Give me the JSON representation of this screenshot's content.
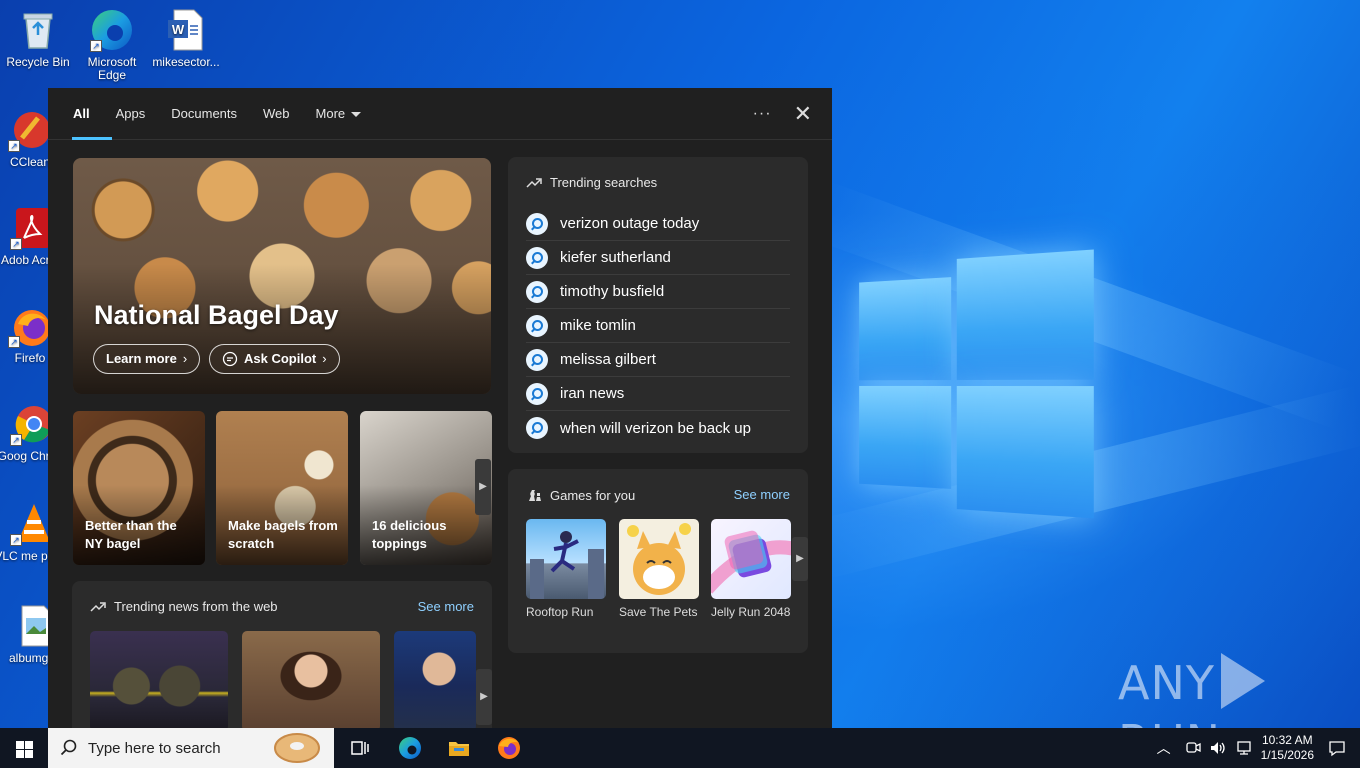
{
  "desktop": {
    "icons": [
      {
        "label": "Recycle Bin"
      },
      {
        "label": "Microsoft Edge"
      },
      {
        "label": "mikesector..."
      },
      {
        "label": "CClean"
      },
      {
        "label": "Adob Acrob"
      },
      {
        "label": "Firefo"
      },
      {
        "label": "Goog Chrom"
      },
      {
        "label": "VLC me playe"
      },
      {
        "label": "albumge"
      }
    ],
    "watermark": "ANY RUN"
  },
  "search_panel": {
    "tabs": [
      {
        "label": "All",
        "active": true
      },
      {
        "label": "Apps"
      },
      {
        "label": "Documents"
      },
      {
        "label": "Web"
      },
      {
        "label": "More"
      }
    ],
    "more_options": "···",
    "close": "✕",
    "hero": {
      "title": "National Bagel Day",
      "learn_more": "Learn more",
      "ask_copilot": "Ask Copilot"
    },
    "cards": [
      {
        "caption": "Better than the NY bagel"
      },
      {
        "caption": "Make bagels from scratch"
      },
      {
        "caption": "16 delicious toppings"
      }
    ],
    "trending_searches": {
      "title": "Trending searches",
      "items": [
        "verizon outage today",
        "kiefer sutherland",
        "timothy busfield",
        "mike tomlin",
        "melissa gilbert",
        "iran news",
        "when will verizon be back up"
      ]
    },
    "games": {
      "title": "Games for you",
      "see_more": "See more",
      "items": [
        {
          "name": "Rooftop Run"
        },
        {
          "name": "Save The Pets"
        },
        {
          "name": "Jelly Run 2048"
        }
      ]
    },
    "trending_news": {
      "title": "Trending news from the web",
      "see_more": "See more"
    }
  },
  "taskbar": {
    "search_placeholder": "Type here to search",
    "time": "10:32 AM",
    "date": "1/15/2026"
  },
  "colors": {
    "accent": "#4cc2ff",
    "panel_bg": "#202020",
    "box_bg": "#2b2b2b",
    "link": "#8fd0ff",
    "taskbar_bg": "#101622"
  }
}
